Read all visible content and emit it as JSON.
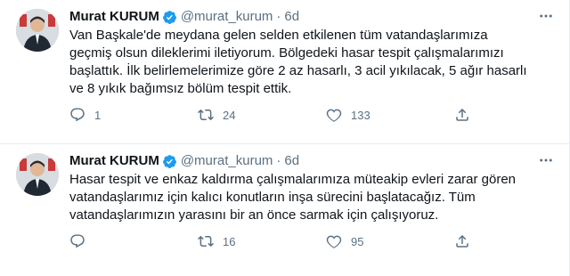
{
  "tweets": [
    {
      "author_name": "Murat KURUM",
      "handle": "@murat_kurum",
      "separator": "·",
      "time": "6d",
      "text": "Van Başkale'de meydana gelen selden etkilenen tüm vatandaşlarımıza\ngeçmiş olsun dileklerimi iletiyorum. Bölgedeki hasar tespit çalışmalarımızı\nbaşlattık. İlk belirlemelerimize göre 2 az hasarlı, 3 acil yıkılacak, 5 ağır hasarlı\nve 8 yıkık bağımsız bölüm tespit ettik.",
      "replies": "1",
      "retweets": "24",
      "likes": "133"
    },
    {
      "author_name": "Murat KURUM",
      "handle": "@murat_kurum",
      "separator": "·",
      "time": "6d",
      "text": "Hasar tespit ve enkaz kaldırma çalışmalarımıza müteakip evleri zarar gören\nvatandaşlarımız için kalıcı konutların inşa sürecini başlatacağız. Tüm\nvatandaşlarımızın yarasını bir an önce sarmak için çalışıyoruz.",
      "replies": "",
      "retweets": "16",
      "likes": "95"
    }
  ],
  "colors": {
    "text": "#0f1419",
    "secondary": "#5b7083",
    "verified": "#1d9bf0",
    "divider": "#e6ecf0"
  },
  "icons": [
    "verified-badge-icon",
    "more-options-icon",
    "reply-icon",
    "retweet-icon",
    "like-icon",
    "share-icon"
  ]
}
